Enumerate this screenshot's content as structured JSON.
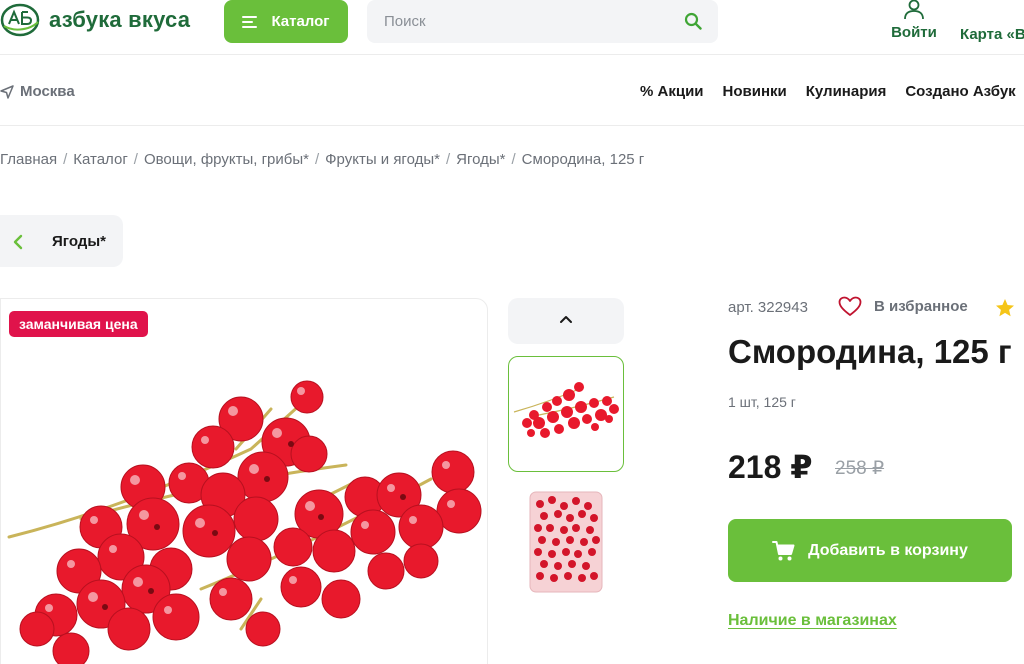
{
  "header": {
    "logo_text": "азбука вкуса",
    "catalog_label": "Каталог",
    "search_placeholder": "Поиск",
    "login_label": "Войти",
    "card_label": "Карта «В"
  },
  "subnav": {
    "city": "Москва",
    "links": [
      "% Акции",
      "Новинки",
      "Кулинария",
      "Создано Азбук"
    ]
  },
  "breadcrumb": [
    "Главная",
    "Каталог",
    "Овощи, фрукты, грибы*",
    "Фрукты и ягоды*",
    "Ягоды*",
    "Смородина, 125 г"
  ],
  "back_label": "Ягоды*",
  "product": {
    "badge": "заманчивая цена",
    "sku": "арт. 322943",
    "favorite_label": "В избранное",
    "title": "Смородина, 125 г",
    "unit": "1 шт, 125 г",
    "price": "218 ₽",
    "old_price": "258 ₽",
    "cart_label": "Добавить в корзину",
    "stores_label": "Наличие в магазинах"
  },
  "colors": {
    "brand_green": "#6abf3b",
    "dark_green": "#1f6b3a",
    "promo_red": "#e0134b",
    "berry_red": "#e8192c",
    "star_yellow": "#f5c518"
  }
}
